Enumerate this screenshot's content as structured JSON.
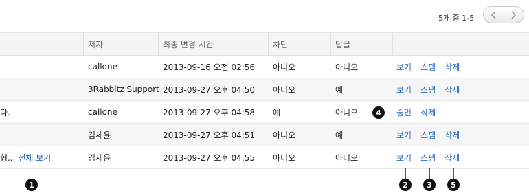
{
  "pager": {
    "count_text": "5개 중 1-5",
    "prev_icon": "chevron-left-icon",
    "next_icon": "chevron-right-icon"
  },
  "table": {
    "headers": {
      "author": "저자",
      "time": "최종 변경 시간",
      "block": "차단",
      "reply": "답글"
    },
    "rows": [
      {
        "msg": "",
        "author": "callone",
        "time": "2013-09-16 오전 02:56",
        "block": "아니오",
        "reply": "아니오",
        "actions": [
          "보기",
          "스팸",
          "삭제"
        ]
      },
      {
        "msg": "",
        "author": "3Rabbitz Support",
        "time": "2013-09-27 오후 04:50",
        "block": "아니오",
        "reply": "예",
        "actions": [
          "보기",
          "스팸",
          "삭제"
        ]
      },
      {
        "msg": "다.",
        "author": "callone",
        "time": "2013-09-27 오후 04:58",
        "block": "예",
        "reply": "아니오",
        "actions": [
          "승인",
          "삭제"
        ]
      },
      {
        "msg": "",
        "author": "김세윤",
        "time": "2013-09-27 오후 04:51",
        "block": "아니오",
        "reply": "예",
        "actions": [
          "보기",
          "스팸",
          "삭제"
        ]
      },
      {
        "msg": "형...",
        "msg_link": "전체 보기",
        "author": "김세윤",
        "time": "2013-09-27 오후 04:55",
        "block": "아니오",
        "reply": "아니오",
        "actions": [
          "보기",
          "스팸",
          "삭제"
        ]
      }
    ]
  },
  "callouts": {
    "b1": "1",
    "b2": "2",
    "b3": "3",
    "b4": "4",
    "b5": "5"
  }
}
